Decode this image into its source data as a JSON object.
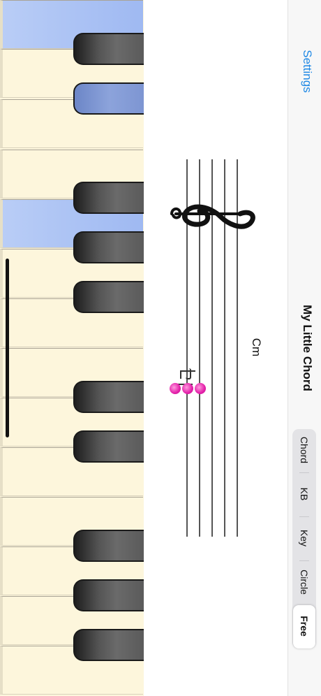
{
  "header": {
    "settings_label": "Settings",
    "title": "My Little Chord"
  },
  "staff": {
    "chord_symbol": "Cm"
  },
  "tabs": [
    {
      "label": "Chord",
      "active": false
    },
    {
      "label": "KB",
      "active": false
    },
    {
      "label": "Key",
      "active": false
    },
    {
      "label": "Circle",
      "active": false
    },
    {
      "label": "Free",
      "active": true
    }
  ],
  "colors": {
    "accent": "#1e88e5",
    "note": "#e31fa9",
    "highlight": "#a6bff3"
  }
}
